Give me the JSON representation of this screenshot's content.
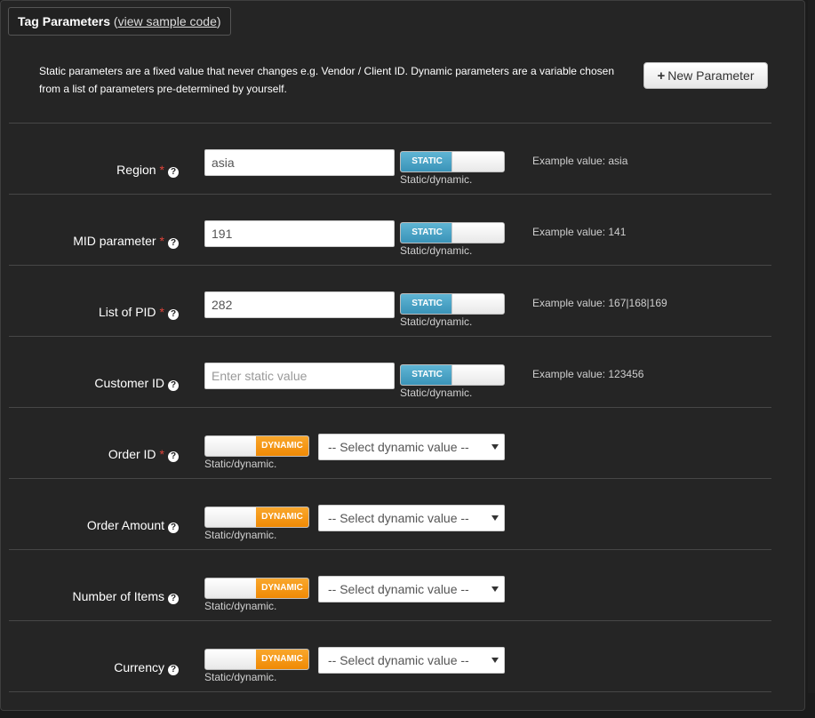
{
  "header": {
    "title": "Tag Parameters",
    "link_open": "(",
    "link_text": "view sample code",
    "link_close": ")"
  },
  "intro": "Static parameters are a fixed value that never changes e.g. Vendor / Client ID. Dynamic parameters are a variable chosen from a list of parameters pre-determined by yourself.",
  "new_param_button": "New Parameter",
  "toggle_hint": "Static/dynamic.",
  "static_params": [
    {
      "label": "Region",
      "required": true,
      "value": "asia",
      "placeholder": "Enter static value",
      "mode": "STATIC",
      "example": "Example value: asia"
    },
    {
      "label": "MID parameter",
      "required": true,
      "value": "191",
      "placeholder": "Enter static value",
      "mode": "STATIC",
      "example": "Example value: 141"
    },
    {
      "label": "List of PID",
      "required": true,
      "value": "282",
      "placeholder": "Enter static value",
      "mode": "STATIC",
      "example": "Example value: 167|168|169"
    },
    {
      "label": "Customer ID",
      "required": false,
      "value": "",
      "placeholder": "Enter static value",
      "mode": "STATIC",
      "example": "Example value: 123456"
    }
  ],
  "dynamic_params": [
    {
      "label": "Order ID",
      "required": true,
      "mode": "DYNAMIC",
      "selected": "-- Select dynamic value --"
    },
    {
      "label": "Order Amount",
      "required": false,
      "mode": "DYNAMIC",
      "selected": "-- Select dynamic value --"
    },
    {
      "label": "Number of Items",
      "required": false,
      "mode": "DYNAMIC",
      "selected": "-- Select dynamic value --"
    },
    {
      "label": "Currency",
      "required": false,
      "mode": "DYNAMIC",
      "selected": "-- Select dynamic value --"
    }
  ],
  "colors": {
    "static_toggle": "#3a93b8",
    "dynamic_toggle": "#f08a05",
    "required_star": "#e0443a",
    "panel_bg": "#252525"
  }
}
